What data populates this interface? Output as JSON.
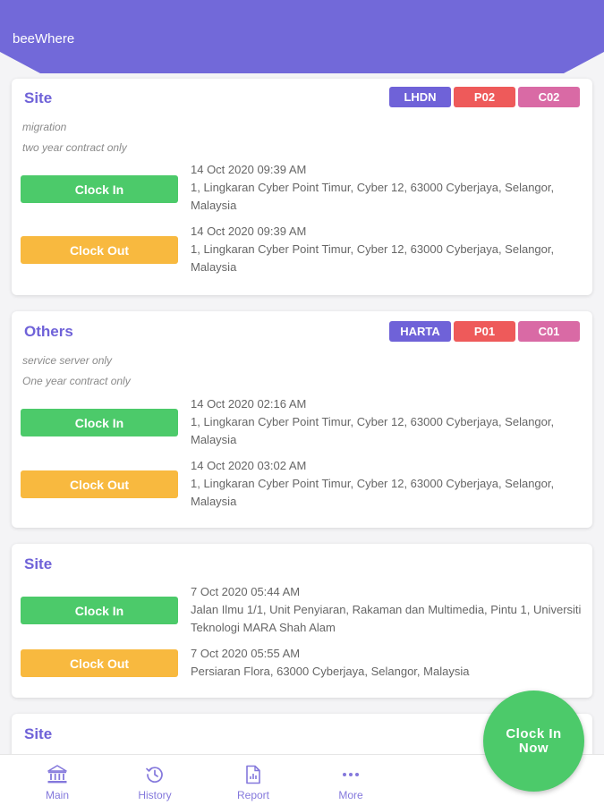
{
  "app": {
    "title": "beeWhere"
  },
  "colors": {
    "primary": "#6f62d8",
    "clock_in": "#4cca6a",
    "clock_out": "#f8b93f",
    "tag_client": "#6f62d8",
    "tag_project": "#ee5a5a",
    "tag_contract": "#d96aa5"
  },
  "cards": [
    {
      "title": "Site",
      "tags": [
        "LHDN",
        "P02",
        "C02"
      ],
      "notes": [
        "migration",
        "two year contract only"
      ],
      "entries": [
        {
          "button": "Clock In",
          "time": "14 Oct 2020 09:39 AM",
          "address": "1, Lingkaran Cyber Point Timur, Cyber 12, 63000 Cyberjaya, Selangor, Malaysia"
        },
        {
          "button": "Clock Out",
          "time": "14 Oct 2020 09:39 AM",
          "address": "1, Lingkaran Cyber Point Timur, Cyber 12, 63000 Cyberjaya, Selangor, Malaysia"
        }
      ]
    },
    {
      "title": "Others",
      "tags": [
        "HARTA",
        "P01",
        "C01"
      ],
      "notes": [
        "service server only",
        "One year contract only"
      ],
      "entries": [
        {
          "button": "Clock In",
          "time": "14 Oct 2020 02:16 AM",
          "address": "1, Lingkaran Cyber Point Timur, Cyber 12, 63000 Cyberjaya, Selangor, Malaysia"
        },
        {
          "button": "Clock Out",
          "time": "14 Oct 2020 03:02 AM",
          "address": "1, Lingkaran Cyber Point Timur, Cyber 12, 63000 Cyberjaya, Selangor, Malaysia"
        }
      ]
    },
    {
      "title": "Site",
      "entries": [
        {
          "button": "Clock In",
          "time": "7 Oct 2020 05:44 AM",
          "address": "Jalan Ilmu 1/1, Unit Penyiaran, Rakaman dan Multimedia, Pintu 1, Universiti Teknologi MARA Shah Alam"
        },
        {
          "button": "Clock Out",
          "time": "7 Oct 2020 05:55 AM",
          "address": "Persiaran Flora, 63000 Cyberjaya, Selangor, Malaysia"
        }
      ]
    },
    {
      "title": "Site"
    }
  ],
  "fab": {
    "label_line1": "Clock In",
    "label_line2": "Now"
  },
  "nav": [
    {
      "label": "Main",
      "icon": "bank-icon"
    },
    {
      "label": "History",
      "icon": "history-icon"
    },
    {
      "label": "Report",
      "icon": "report-icon"
    },
    {
      "label": "More",
      "icon": "more-icon"
    }
  ]
}
